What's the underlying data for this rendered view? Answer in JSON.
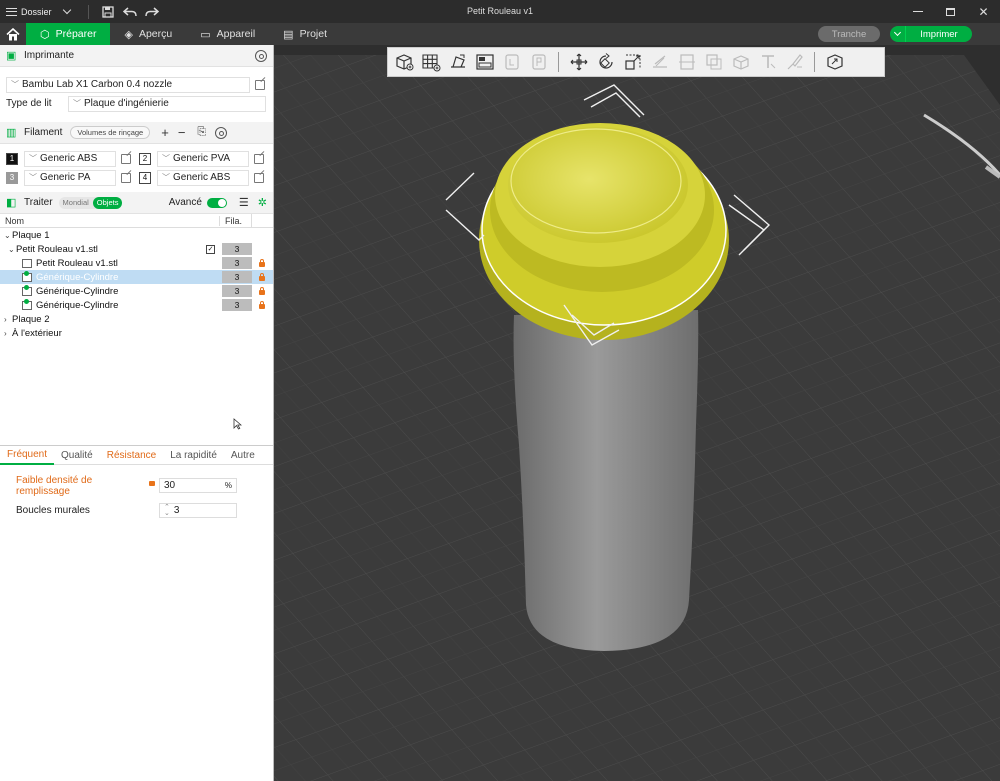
{
  "app": {
    "title": "Petit Rouleau v1",
    "menu_label": "Dossier"
  },
  "tabs": [
    {
      "label": "Préparer",
      "active": true
    },
    {
      "label": "Aperçu",
      "active": false
    },
    {
      "label": "Appareil",
      "active": false
    },
    {
      "label": "Projet",
      "active": false
    }
  ],
  "actions": {
    "slice_label": "Tranche",
    "print_label": "Imprimer"
  },
  "printer": {
    "section_title": "Imprimante",
    "model": "Bambu Lab X1 Carbon 0.4 nozzle",
    "bed_label": "Type de lit",
    "bed_value": "Plaque d'ingénierie"
  },
  "filament": {
    "section_title": "Filament",
    "rinse_label": "Volumes de rinçage",
    "slots": [
      {
        "num": "1",
        "name": "Generic ABS"
      },
      {
        "num": "2",
        "name": "Generic PVA"
      },
      {
        "num": "3",
        "name": "Generic PA"
      },
      {
        "num": "4",
        "name": "Generic ABS"
      }
    ]
  },
  "process": {
    "section_title": "Traiter",
    "mode_global": "Mondial",
    "mode_objects": "Objets",
    "advanced_label": "Avancé"
  },
  "tree": {
    "col_name": "Nom",
    "col_fila": "Fila.",
    "rows": [
      {
        "label": "Plaque 1",
        "fila": ""
      },
      {
        "label": "Petit Rouleau v1.stl",
        "fila": "3"
      },
      {
        "label": "Petit Rouleau v1.stl",
        "fila": "3"
      },
      {
        "label": "Générique-Cylindre",
        "fila": "3"
      },
      {
        "label": "Générique-Cylindre",
        "fila": "3"
      },
      {
        "label": "Générique-Cylindre",
        "fila": "3"
      },
      {
        "label": "Plaque 2",
        "fila": ""
      },
      {
        "label": "À l'extérieur",
        "fila": ""
      }
    ]
  },
  "param_tabs": [
    "Fréquent",
    "Qualité",
    "Résistance",
    "La rapidité",
    "Autre"
  ],
  "params": {
    "infill_label": "Faible densité de remplissage",
    "infill_value": "30",
    "infill_unit": "%",
    "walls_label": "Boucles murales",
    "walls_value": "3"
  },
  "colors": {
    "accent": "#00ae42",
    "highlight": "#e06a18",
    "model_yellow": "#d8d42a",
    "model_gray": "#8a8a8a",
    "bed": "#3d3d3d"
  }
}
